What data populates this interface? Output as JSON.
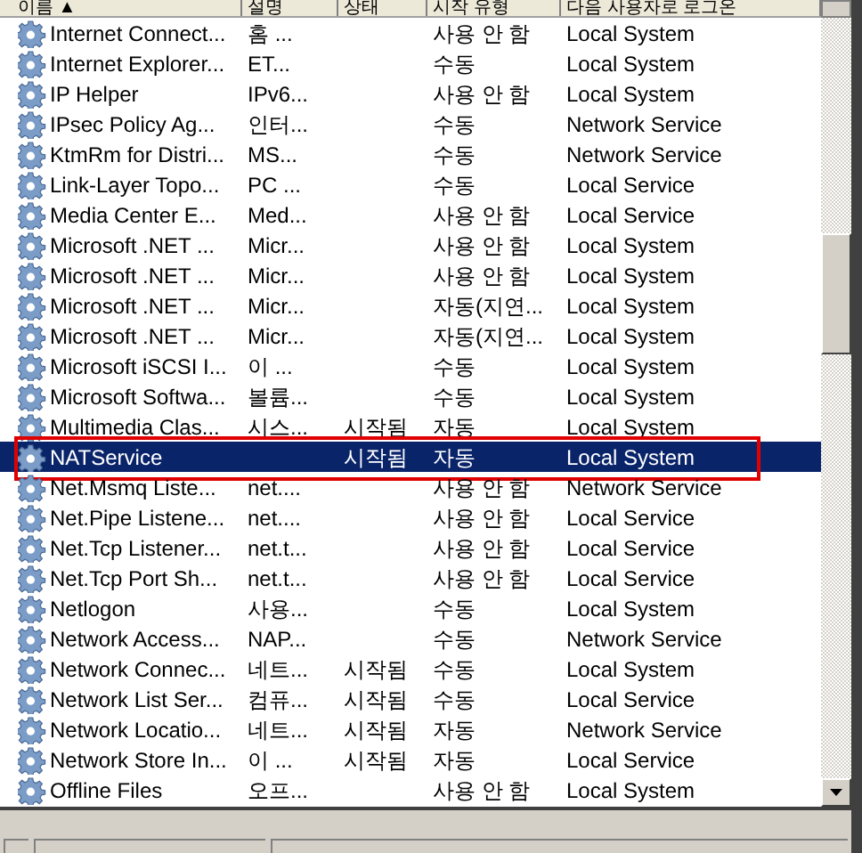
{
  "columns": [
    "이름 ▲",
    "설명",
    "상태",
    "시작 유형",
    "다음 사용자로 로그온"
  ],
  "rows": [
    {
      "name": "Internet Connect...",
      "description": "홈 ...",
      "status": "",
      "startup": "사용 안 함",
      "logon": "Local System",
      "selected": false,
      "outlined": false
    },
    {
      "name": "Internet Explorer...",
      "description": "ET...",
      "status": "",
      "startup": "수동",
      "logon": "Local System",
      "selected": false,
      "outlined": false
    },
    {
      "name": "IP Helper",
      "description": "IPv6...",
      "status": "",
      "startup": "사용 안 함",
      "logon": "Local System",
      "selected": false,
      "outlined": false
    },
    {
      "name": "IPsec Policy Ag...",
      "description": "인터...",
      "status": "",
      "startup": "수동",
      "logon": "Network Service",
      "selected": false,
      "outlined": false
    },
    {
      "name": "KtmRm for Distri...",
      "description": "MS...",
      "status": "",
      "startup": "수동",
      "logon": "Network Service",
      "selected": false,
      "outlined": false
    },
    {
      "name": "Link-Layer Topo...",
      "description": "PC ...",
      "status": "",
      "startup": "수동",
      "logon": "Local Service",
      "selected": false,
      "outlined": false
    },
    {
      "name": "Media Center E...",
      "description": "Med...",
      "status": "",
      "startup": "사용 안 함",
      "logon": "Local Service",
      "selected": false,
      "outlined": false
    },
    {
      "name": "Microsoft .NET ...",
      "description": "Micr...",
      "status": "",
      "startup": "사용 안 함",
      "logon": "Local System",
      "selected": false,
      "outlined": false
    },
    {
      "name": "Microsoft .NET ...",
      "description": "Micr...",
      "status": "",
      "startup": "사용 안 함",
      "logon": "Local System",
      "selected": false,
      "outlined": false
    },
    {
      "name": "Microsoft .NET ...",
      "description": "Micr...",
      "status": "",
      "startup": "자동(지연...",
      "logon": "Local System",
      "selected": false,
      "outlined": false
    },
    {
      "name": "Microsoft .NET ...",
      "description": "Micr...",
      "status": "",
      "startup": "자동(지연...",
      "logon": "Local System",
      "selected": false,
      "outlined": false
    },
    {
      "name": "Microsoft iSCSI I...",
      "description": "이 ...",
      "status": "",
      "startup": "수동",
      "logon": "Local System",
      "selected": false,
      "outlined": false
    },
    {
      "name": "Microsoft Softwa...",
      "description": "볼륨...",
      "status": "",
      "startup": "수동",
      "logon": "Local System",
      "selected": false,
      "outlined": false
    },
    {
      "name": "Multimedia Clas...",
      "description": "시스...",
      "status": "시작됨",
      "startup": "자동",
      "logon": "Local System",
      "selected": false,
      "outlined": false
    },
    {
      "name": "NATService",
      "description": "",
      "status": "시작됨",
      "startup": "자동",
      "logon": "Local System",
      "selected": true,
      "outlined": true
    },
    {
      "name": "Net.Msmq Liste...",
      "description": "net....",
      "status": "",
      "startup": "사용 안 함",
      "logon": "Network Service",
      "selected": false,
      "outlined": false
    },
    {
      "name": "Net.Pipe Listene...",
      "description": "net....",
      "status": "",
      "startup": "사용 안 함",
      "logon": "Local Service",
      "selected": false,
      "outlined": false
    },
    {
      "name": "Net.Tcp Listener...",
      "description": "net.t...",
      "status": "",
      "startup": "사용 안 함",
      "logon": "Local Service",
      "selected": false,
      "outlined": false
    },
    {
      "name": "Net.Tcp Port Sh...",
      "description": "net.t...",
      "status": "",
      "startup": "사용 안 함",
      "logon": "Local Service",
      "selected": false,
      "outlined": false
    },
    {
      "name": "Netlogon",
      "description": "사용...",
      "status": "",
      "startup": "수동",
      "logon": "Local System",
      "selected": false,
      "outlined": false
    },
    {
      "name": "Network Access...",
      "description": "NAP...",
      "status": "",
      "startup": "수동",
      "logon": "Network Service",
      "selected": false,
      "outlined": false
    },
    {
      "name": "Network Connec...",
      "description": "네트...",
      "status": "시작됨",
      "startup": "수동",
      "logon": "Local System",
      "selected": false,
      "outlined": false
    },
    {
      "name": "Network List Ser...",
      "description": "컴퓨...",
      "status": "시작됨",
      "startup": "수동",
      "logon": "Local Service",
      "selected": false,
      "outlined": false
    },
    {
      "name": "Network Locatio...",
      "description": "네트...",
      "status": "시작됨",
      "startup": "자동",
      "logon": "Network Service",
      "selected": false,
      "outlined": false
    },
    {
      "name": "Network Store In...",
      "description": "이 ...",
      "status": "시작됨",
      "startup": "자동",
      "logon": "Local Service",
      "selected": false,
      "outlined": false
    },
    {
      "name": "Offline Files",
      "description": "오프...",
      "status": "",
      "startup": "사용 안 함",
      "logon": "Local System",
      "selected": false,
      "outlined": false
    }
  ]
}
